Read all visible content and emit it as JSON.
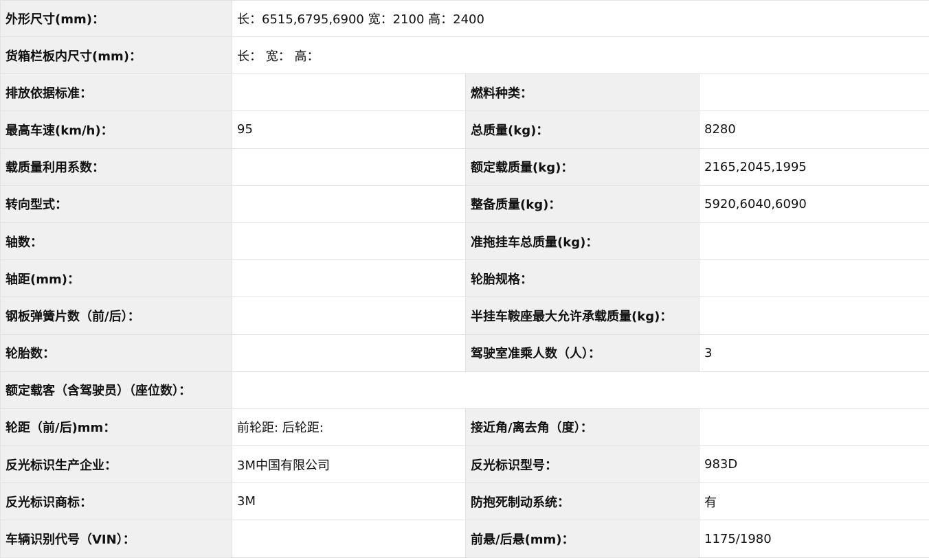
{
  "rows": [
    {
      "label": "外形尺寸(mm)：",
      "value": "长：6515,6795,6900 宽：2100 高：2400"
    },
    {
      "label": "货箱栏板内尺寸(mm)：",
      "value": "长：  宽：  高："
    },
    {
      "label": "排放依据标准：",
      "value": "",
      "label2": "燃料种类：",
      "value2": ""
    },
    {
      "label": "最高车速(km/h)：",
      "value": "95",
      "label2": "总质量(kg)：",
      "value2": "8280"
    },
    {
      "label": "载质量利用系数：",
      "value": "",
      "label2": "额定载质量(kg)：",
      "value2": "2165,2045,1995"
    },
    {
      "label": "转向型式：",
      "value": "",
      "label2": "整备质量(kg)：",
      "value2": "5920,6040,6090"
    },
    {
      "label": "轴数：",
      "value": "",
      "label2": "准拖挂车总质量(kg)：",
      "value2": ""
    },
    {
      "label": "轴距(mm)：",
      "value": "",
      "label2": "轮胎规格：",
      "value2": ""
    },
    {
      "label": "钢板弹簧片数（前/后）：",
      "value": "",
      "label2": "半挂车鞍座最大允许承载质量(kg)：",
      "value2": ""
    },
    {
      "label": "轮胎数：",
      "value": "",
      "label2": "驾驶室准乘人数（人）：",
      "value2": "3"
    },
    {
      "label": "额定载客（含驾驶员）（座位数）：",
      "value": ""
    },
    {
      "label": "轮距（前/后)mm：",
      "value": "前轮距: 后轮距:",
      "label2": "接近角/离去角（度）：",
      "value2": ""
    },
    {
      "label": "反光标识生产企业：",
      "value": "3M中国有限公司",
      "label2": "反光标识型号：",
      "value2": "983D"
    },
    {
      "label": "反光标识商标：",
      "value": "3M",
      "label2": "防抱死制动系统：",
      "value2": "有"
    },
    {
      "label": "车辆识别代号（VIN）：",
      "value": "",
      "label2": "前悬/后悬(mm)：",
      "value2": "1175/1980"
    }
  ]
}
